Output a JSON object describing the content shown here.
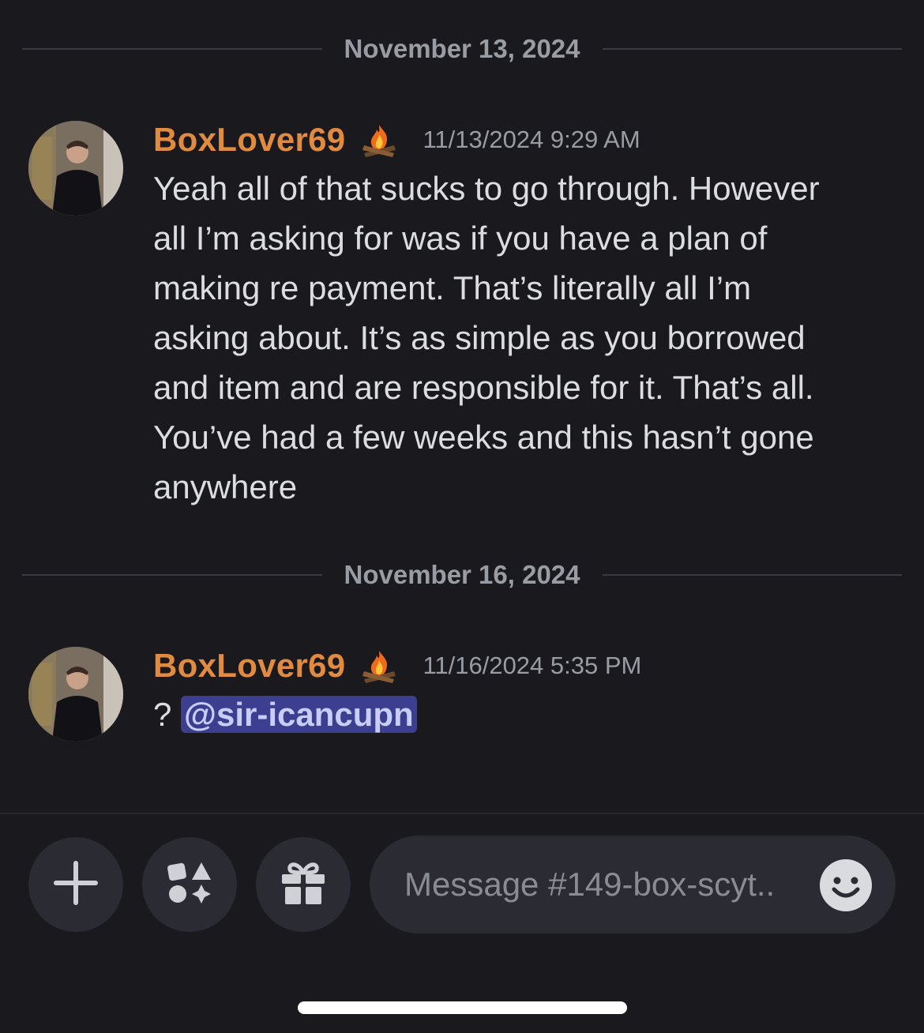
{
  "dividers": [
    {
      "label": "November 13, 2024"
    },
    {
      "label": "November 16, 2024"
    }
  ],
  "messages": [
    {
      "username": "BoxLover69",
      "badge_icon": "campfire-icon",
      "timestamp": "11/13/2024 9:29 AM",
      "lines": [
        "Yeah all of that sucks to go through. However",
        "all I’m asking for was if you have a plan of",
        "making re payment. That’s literally all I’m",
        "asking about. It’s as simple as you borrowed",
        "and item and are responsible for it. That’s all.",
        "You’ve had a few weeks and this hasn’t gone",
        "anywhere"
      ]
    },
    {
      "username": "BoxLover69",
      "badge_icon": "campfire-icon",
      "timestamp": "11/16/2024 5:35 PM",
      "prefix": "? ",
      "mention": "@sir-icancupn"
    }
  ],
  "composer": {
    "placeholder": "Message #149-box-scyt..",
    "buttons": [
      "plus-icon",
      "apps-icon",
      "gift-icon",
      "emoji-icon"
    ]
  },
  "colors": {
    "background": "#1a1a1e",
    "username": "#e08b3f",
    "mention_bg": "#3c3f8f",
    "mention_text": "#c9cdfb"
  }
}
